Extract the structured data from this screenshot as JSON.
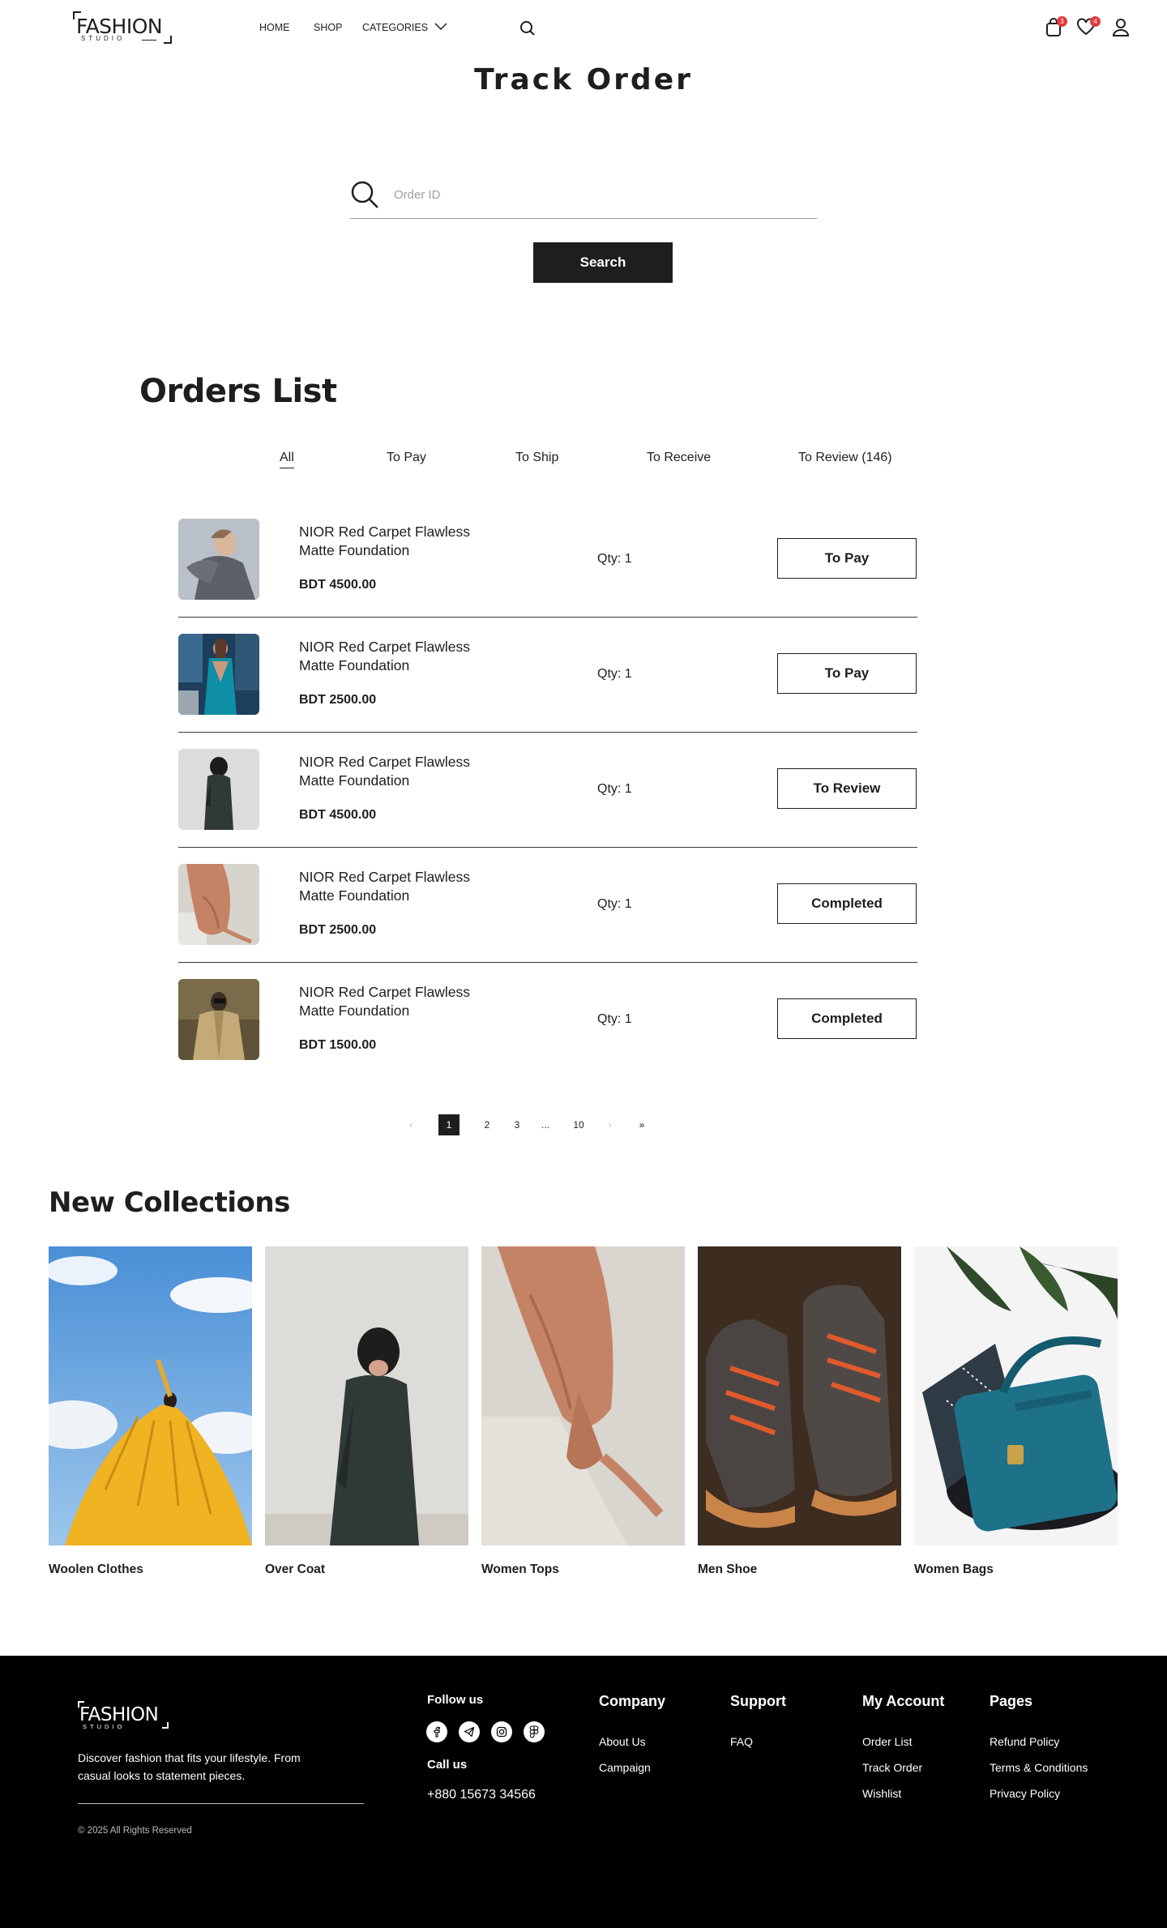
{
  "header": {
    "logo_text": "FASHION",
    "logo_sub": "STUDIO",
    "nav": {
      "home": "HOME",
      "shop": "SHOP",
      "categories": "CATEGORIES"
    },
    "cart_count": "3",
    "wishlist_count": "4"
  },
  "track": {
    "title": "Track Order",
    "placeholder": "Order ID",
    "button": "Search"
  },
  "orders": {
    "title": "Orders List",
    "tabs": [
      "All",
      "To Pay",
      "To Ship",
      "To Receive",
      "To Review (146)"
    ],
    "items": [
      {
        "name": "NIOR Red Carpet Flawless Matte Foundation",
        "price": "BDT 4500.00",
        "qty": "Qty: 1",
        "status": "To Pay"
      },
      {
        "name": "NIOR Red Carpet Flawless Matte Foundation",
        "price": "BDT 2500.00",
        "qty": "Qty: 1",
        "status": "To Pay"
      },
      {
        "name": "NIOR Red Carpet Flawless Matte Foundation",
        "price": "BDT 4500.00",
        "qty": "Qty: 1",
        "status": "To Review"
      },
      {
        "name": "NIOR Red Carpet Flawless Matte Foundation",
        "price": "BDT 2500.00",
        "qty": "Qty: 1",
        "status": "Completed"
      },
      {
        "name": "NIOR Red Carpet Flawless Matte Foundation",
        "price": "BDT 1500.00",
        "qty": "Qty: 1",
        "status": "Completed"
      }
    ]
  },
  "pagination": {
    "prev": "‹",
    "pages": [
      "1",
      "2",
      "3",
      "...",
      "10"
    ],
    "current": "1",
    "next": "›",
    "last": "»"
  },
  "collections": {
    "title": "New Collections",
    "items": [
      "Woolen Clothes",
      "Over Coat",
      "Women Tops",
      "Men Shoe",
      "Women Bags"
    ]
  },
  "footer": {
    "logo_text": "FASHION",
    "logo_sub": "STUDIO",
    "description": "Discover fashion that fits your lifestyle. From casual looks to statement pieces.",
    "copyright": "© 2025 All Rights Reserved",
    "follow_title": "Follow us",
    "social_icons": [
      "facebook-icon",
      "telegram-icon",
      "instagram-icon",
      "figma-icon"
    ],
    "call_title": "Call us",
    "phone": "+880 15673 34566",
    "company": {
      "title": "Company",
      "links": [
        "About Us",
        "Campaign"
      ]
    },
    "support": {
      "title": "Support",
      "links": [
        "FAQ"
      ]
    },
    "account": {
      "title": "My Account",
      "links": [
        "Order List",
        "Track Order",
        "Wishlist"
      ]
    },
    "pages": {
      "title": "Pages",
      "links": [
        "Refund Policy",
        "Terms & Conditions",
        "Privacy Policy"
      ]
    }
  },
  "colors": {
    "primary": "#1e1e1e",
    "badge": "#e23b3b",
    "footer_bg": "#000000"
  }
}
